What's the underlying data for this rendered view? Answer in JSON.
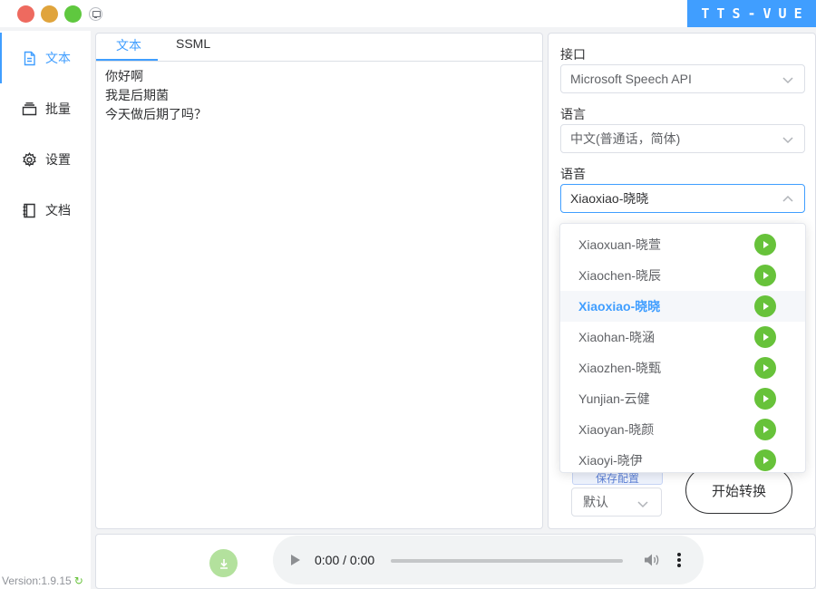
{
  "app": {
    "brand": "TTS-VUE"
  },
  "sidebar": {
    "items": [
      {
        "label": "文本",
        "icon": "document-icon",
        "active": true
      },
      {
        "label": "批量",
        "icon": "batch-icon",
        "active": false
      },
      {
        "label": "设置",
        "icon": "gear-icon",
        "active": false
      },
      {
        "label": "文档",
        "icon": "notebook-icon",
        "active": false
      }
    ],
    "version": "Version:1.9.15"
  },
  "editor": {
    "tabs": [
      {
        "label": "文本",
        "active": true
      },
      {
        "label": "SSML",
        "active": false
      }
    ],
    "lines": [
      "你好啊",
      "我是后期菌",
      "今天做后期了吗？"
    ]
  },
  "config": {
    "api_label": "接口",
    "api_value": "Microsoft Speech API",
    "language_label": "语言",
    "language_value": "中文(普通话，简体)",
    "voice_label": "语音",
    "voice_value": "Xiaoxiao-晓晓",
    "save_config_label": "保存配置",
    "format_value": "默认",
    "start_button": "开始转换"
  },
  "voice_dropdown": {
    "options": [
      "Xiaoxuan-晓萱",
      "Xiaochen-晓辰",
      "Xiaoxiao-晓晓",
      "Xiaohan-晓涵",
      "Xiaozhen-晓甄",
      "Yunjian-云健",
      "Xiaoyan-晓颜",
      "Xiaoyi-晓伊"
    ],
    "selected": "Xiaoxiao-晓晓"
  },
  "player": {
    "time": "0:00 / 0:00"
  },
  "colors": {
    "accent": "#409eff",
    "play": "#67c23a",
    "download": "#b3e19d"
  }
}
